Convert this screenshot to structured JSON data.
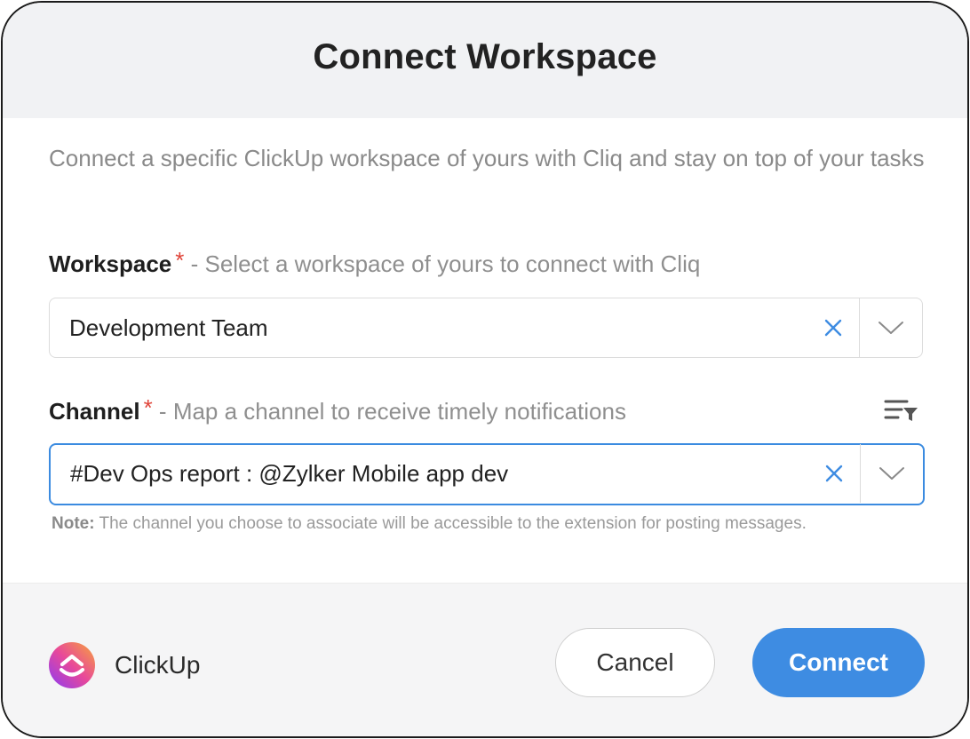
{
  "dialog": {
    "title": "Connect Workspace",
    "description": "Connect a specific ClickUp workspace of yours with Cliq and stay on top of your tasks"
  },
  "workspace_field": {
    "label": "Workspace",
    "required_marker": "*",
    "separator": " - ",
    "hint": "Select a workspace of yours to connect with Cliq",
    "value": "Development Team"
  },
  "channel_field": {
    "label": "Channel",
    "required_marker": "*",
    "separator": " - ",
    "hint": "Map a channel to receive timely notifications",
    "value": "#Dev Ops report : @Zylker Mobile app dev",
    "note_label": "Note:",
    "note_text": " The channel you choose to associate will be accessible to the extension for posting messages."
  },
  "footer": {
    "brand_name": "ClickUp",
    "cancel_label": "Cancel",
    "connect_label": "Connect"
  },
  "icons": {
    "clear": "close-icon",
    "dropdown": "chevron-down-icon",
    "filter": "filter-list-icon",
    "logo": "clickup-logo-icon"
  },
  "colors": {
    "accent": "#3e8ce2",
    "required": "#e0453a",
    "header_bg": "#f1f2f4",
    "footer_bg": "#f5f5f6"
  }
}
